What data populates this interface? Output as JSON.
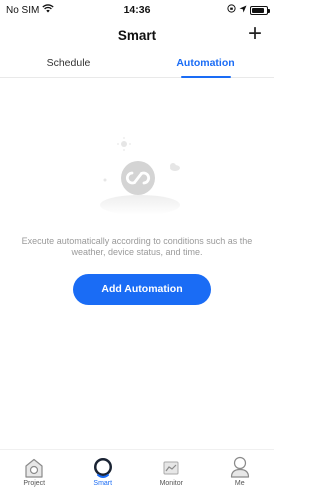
{
  "status_bar": {
    "carrier": "No SIM",
    "time": "14:36"
  },
  "header": {
    "title": "Smart",
    "add_label": "+"
  },
  "tabs": [
    {
      "label": "Schedule",
      "active": false
    },
    {
      "label": "Automation",
      "active": true
    }
  ],
  "empty_state": {
    "description": "Execute automatically according to conditions such as the weather, device status, and time.",
    "button_label": "Add Automation"
  },
  "bottom_nav": [
    {
      "label": "Project",
      "icon": "house-icon",
      "active": false
    },
    {
      "label": "Smart",
      "icon": "smart-bulb-icon",
      "active": true
    },
    {
      "label": "Monitor",
      "icon": "chart-icon",
      "active": false
    },
    {
      "label": "Me",
      "icon": "person-icon",
      "active": false
    }
  ],
  "colors": {
    "accent": "#1A6CF5",
    "muted_text": "#9a9a9a",
    "illustration_grey": "#d6d6d6"
  }
}
